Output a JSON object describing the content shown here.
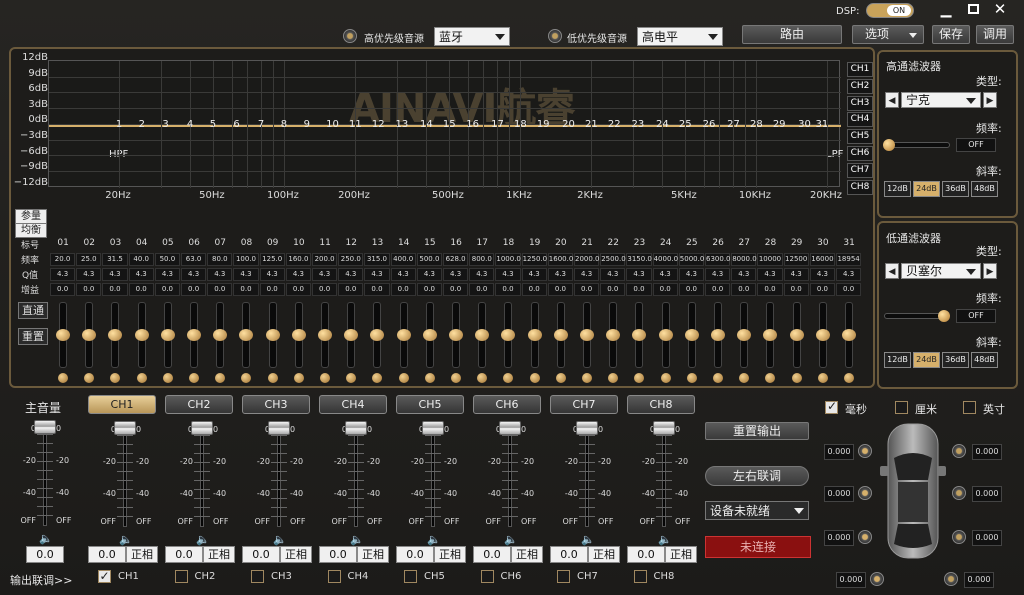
{
  "titlebar": {
    "dsp_label": "DSP:",
    "dsp_toggle": "ON"
  },
  "topbar": {
    "high_priority_label": "高优先级音源",
    "high_priority_value": "蓝牙",
    "low_priority_label": "低优先级音源",
    "low_priority_value": "高电平",
    "route_btn": "路由",
    "options_btn": "选项",
    "save_btn": "保存",
    "tune_btn": "调用"
  },
  "graph": {
    "y_labels": [
      "12dB",
      "9dB",
      "6dB",
      "3dB",
      "0dB",
      "−3dB",
      "−6dB",
      "−9dB",
      "−12dB"
    ],
    "x_labels": [
      "20Hz",
      "50Hz",
      "100Hz",
      "200Hz",
      "500Hz",
      "1KHz",
      "2KHz",
      "5KHz",
      "10KHz",
      "20KHz"
    ],
    "band_numbers": [
      "1",
      "2",
      "3",
      "4",
      "5",
      "6",
      "7",
      "8",
      "9",
      "10",
      "11",
      "12",
      "13",
      "14",
      "15",
      "16",
      "17",
      "18",
      "19",
      "20",
      "21",
      "22",
      "23",
      "24",
      "25",
      "26",
      "27",
      "28",
      "29",
      "30",
      "31"
    ],
    "hpf": "HPF",
    "lpf": "LPF",
    "logo": "AINAVI航睿",
    "channels": [
      "CH1",
      "CH2",
      "CH3",
      "CH4",
      "CH5",
      "CH6",
      "CH7",
      "CH8"
    ]
  },
  "eq_table": {
    "param_btn": "参量",
    "balance_btn": "均衡",
    "row_labels": [
      "标号",
      "频率",
      "Q值",
      "增益"
    ],
    "ids": [
      "01",
      "02",
      "03",
      "04",
      "05",
      "06",
      "07",
      "08",
      "09",
      "10",
      "11",
      "12",
      "13",
      "14",
      "15",
      "16",
      "17",
      "18",
      "19",
      "20",
      "21",
      "22",
      "23",
      "24",
      "25",
      "26",
      "27",
      "28",
      "29",
      "30",
      "31"
    ],
    "freqs": [
      "20.0",
      "25.0",
      "31.5",
      "40.0",
      "50.0",
      "63.0",
      "80.0",
      "100.0",
      "125.0",
      "160.0",
      "200.0",
      "250.0",
      "315.0",
      "400.0",
      "500.0",
      "628.0",
      "800.0",
      "1000.0",
      "1250.0",
      "1600.0",
      "2000.0",
      "2500.0",
      "3150.0",
      "4000.0",
      "5000.0",
      "6300.0",
      "8000.0",
      "10000",
      "12500",
      "16000",
      "18954"
    ],
    "q": "4.3",
    "gain": "0.0",
    "bypass_btn": "直通",
    "reset_btn": "重置"
  },
  "highpass": {
    "title": "高通滤波器",
    "type_label": "类型:",
    "type_value": "宁克",
    "freq_label": "频率:",
    "freq_value": "OFF",
    "slope_label": "斜率:",
    "slopes": [
      "12dB",
      "24dB",
      "36dB",
      "48dB"
    ],
    "slope_selected": "24dB",
    "slider": 0.0
  },
  "lowpass": {
    "title": "低通滤波器",
    "type_label": "类型:",
    "type_value": "贝塞尔",
    "freq_label": "频率:",
    "freq_value": "OFF",
    "slope_label": "斜率:",
    "slopes": [
      "12dB",
      "24dB",
      "36dB",
      "48dB"
    ],
    "slope_selected": "24dB",
    "slider": 1.0
  },
  "volume": {
    "master_label": "主音量",
    "scale": [
      "0",
      "-20",
      "-40",
      "OFF"
    ],
    "master_value": "0.0",
    "channels": [
      "CH1",
      "CH2",
      "CH3",
      "CH4",
      "CH5",
      "CH6",
      "CH7",
      "CH8"
    ],
    "ch_value": "0.0",
    "phase_btn": "正相",
    "speaker_icon": "speaker-icon"
  },
  "outputs": {
    "reset_output": "重置输出",
    "lr_link": "左右联调",
    "device_status": "设备未就绪",
    "connect_status": "未连接"
  },
  "link": {
    "label": "输出联调>>",
    "channels": [
      "CH1",
      "CH2",
      "CH3",
      "CH4",
      "CH5",
      "CH6",
      "CH7",
      "CH8"
    ],
    "checked": [
      true,
      false,
      false,
      false,
      false,
      false,
      false,
      false
    ]
  },
  "delay": {
    "unit_ms": "毫秒",
    "unit_cm": "厘米",
    "unit_in": "英寸",
    "values": [
      "0.000",
      "0.000",
      "0.000",
      "0.000",
      "0.000",
      "0.000",
      "0.000",
      "0.000"
    ]
  }
}
